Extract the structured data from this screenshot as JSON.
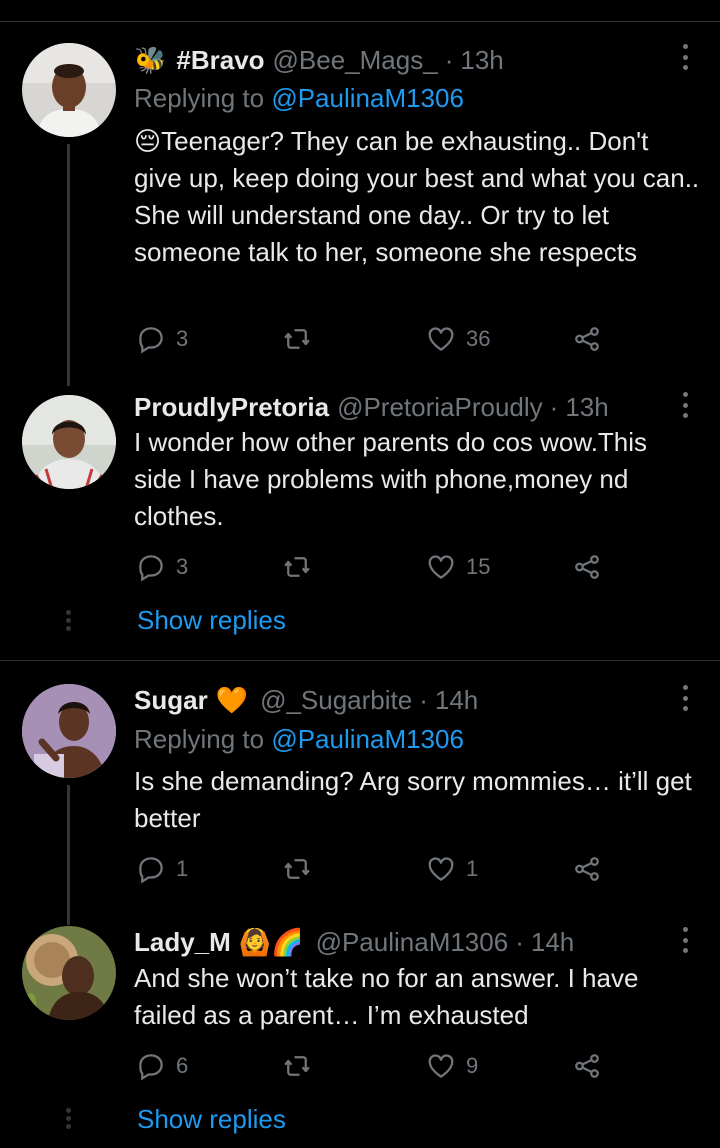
{
  "colors": {
    "background": "#000000",
    "text": "#e7e9ea",
    "muted": "#71767b",
    "accent": "#1d9bf0",
    "divider": "#2f3336"
  },
  "tweets": [
    {
      "name": "#Bravo",
      "name_icon": "bee-emoji",
      "name_icon_glyph": "🐝",
      "handle": "@Bee_Mags_",
      "time": "13h",
      "replying_prefix": "Replying to",
      "replying_handle": "@PaulinaM1306",
      "text_emoji": "😔",
      "text": "Teenager? They can be exhausting.. Don't give up, keep doing your best and what you can.. She will understand one day.. Or try to let someone talk to her, someone she respects",
      "replies": "3",
      "retweets": "",
      "likes": "36"
    },
    {
      "name": "ProudlyPretoria",
      "handle": "@PretoriaProudly",
      "time": "13h",
      "text": "I wonder how other parents do cos wow.This side I have problems with phone,money nd clothes.",
      "replies": "3",
      "retweets": "",
      "likes": "15",
      "show_replies": "Show replies"
    },
    {
      "name": "Sugar",
      "name_icon": "orange-heart-emoji",
      "name_icon_glyph": "🧡",
      "handle": "@_Sugarbite",
      "time": "14h",
      "replying_prefix": "Replying to",
      "replying_handle": "@PaulinaM1306",
      "text": "Is she demanding? Arg sorry mommies… it’ll get better",
      "replies": "1",
      "retweets": "",
      "likes": "1"
    },
    {
      "name": "Lady_M",
      "name_icon": "person-gesturing-ok-and-rainbow-emoji",
      "name_icon_glyph": "🙆🌈",
      "handle": "@PaulinaM1306",
      "time": "14h",
      "text": "And she won’t take no for an answer. I have failed as a parent… I’m exhausted",
      "replies": "6",
      "retweets": "",
      "likes": "9",
      "show_replies": "Show replies"
    }
  ]
}
